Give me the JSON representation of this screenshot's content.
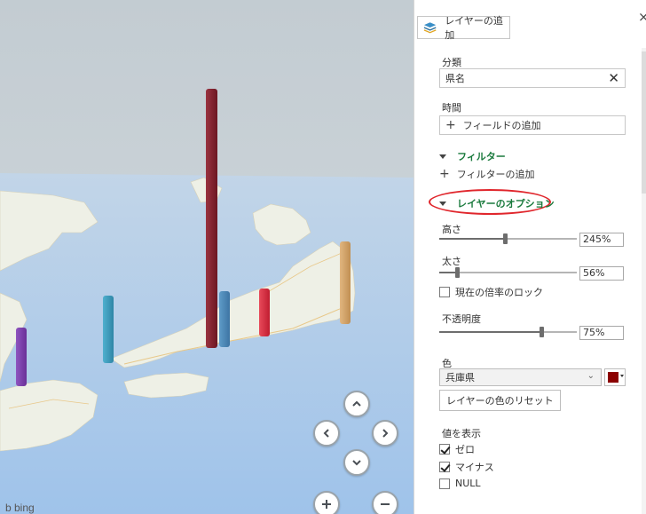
{
  "map": {
    "attribution": "b bing",
    "colors": {
      "sky": "#c7d0d6",
      "sea": "#a9c9ec",
      "land": "#eef0e6"
    },
    "nav": {
      "up": "chevron-up-icon",
      "left": "chevron-left-icon",
      "right": "chevron-right-icon",
      "down": "chevron-down-icon",
      "zoom_in": "plus-icon",
      "zoom_out": "minus-icon"
    },
    "bar_colors": [
      "#7b3fa8",
      "#3b96b8",
      "#7f1f2b",
      "#4c86b5",
      "#d9283c",
      "#d4a66a"
    ]
  },
  "panel": {
    "close": "×",
    "add_layer_label": "レイヤーの追加",
    "category_label": "分類",
    "category_value": "県名",
    "time_label": "時間",
    "add_field_label": "フィールドの追加",
    "filter_section": "フィルター",
    "add_filter_label": "フィルターの追加",
    "layer_options_section": "レイヤーのオプション",
    "height_label": "高さ",
    "height_value": "245%",
    "height_level": 0.48,
    "thickness_label": "太さ",
    "thickness_value": "56%",
    "thickness_level": 0.12,
    "lock_scale_label": "現在の倍率のロック",
    "lock_scale_checked": false,
    "opacity_label": "不透明度",
    "opacity_value": "75%",
    "opacity_level": 0.75,
    "color_label": "色",
    "color_select_value": "兵庫県",
    "color_swatch": "#8b0000",
    "reset_color_label": "レイヤーの色のリセット",
    "show_values_label": "値を表示",
    "show_zero_label": "ゼロ",
    "show_negative_label": "マイナス",
    "show_null_label": "NULL",
    "show_zero_checked": true,
    "show_negative_checked": true,
    "show_null_checked": false,
    "section_accent": "#1a7a3d",
    "highlight_color": "#e0262c"
  }
}
